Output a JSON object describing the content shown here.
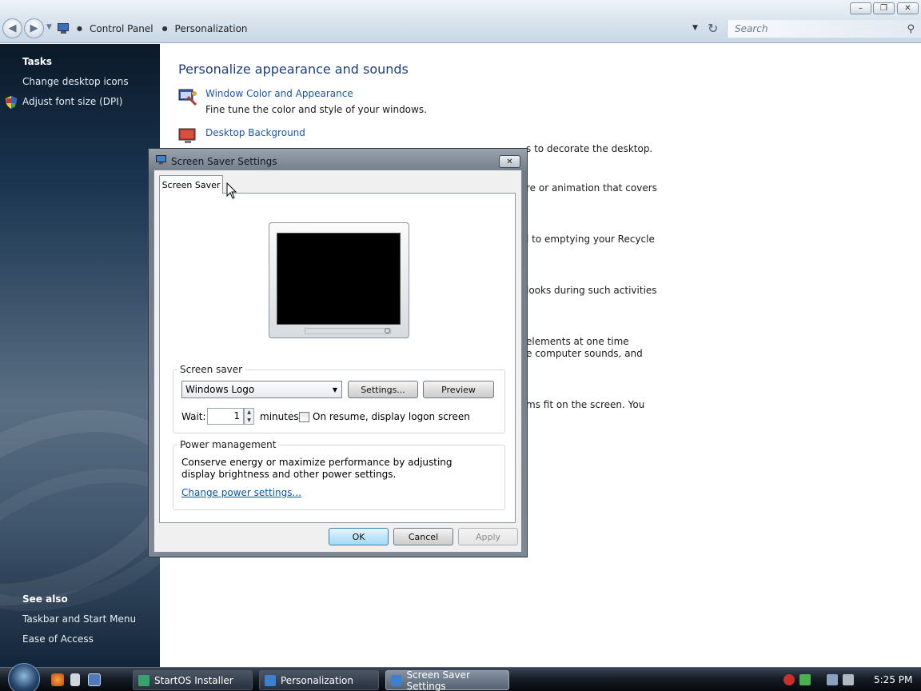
{
  "window": {
    "minimize_glyph": "–",
    "maximize_glyph": "❐",
    "close_glyph": "✕"
  },
  "address_bar": {
    "breadcrumb": [
      "Control Panel",
      "Personalization"
    ],
    "search_placeholder": "Search"
  },
  "sidebar": {
    "tasks_heading": "Tasks",
    "tasks": [
      "Change desktop icons",
      "Adjust font size (DPI)"
    ],
    "see_also_heading": "See also",
    "see_also": [
      "Taskbar and Start Menu",
      "Ease of Access"
    ]
  },
  "main": {
    "title": "Personalize appearance and sounds",
    "items": [
      {
        "link": "Window Color and Appearance",
        "desc": "Fine tune the color and style of your windows.",
        "icon": "window-color-icon"
      },
      {
        "link": "Desktop Background",
        "desc": "Choose from available backgrounds or colors or use one of your own pictures to decorate the desktop.",
        "visible_desc_tail": "s to decorate the desktop.",
        "icon": "desktop-background-icon"
      }
    ],
    "partial_text": [
      "re or animation that covers",
      "l to emptying your Recycle",
      "looks during such activities",
      "elements at one time",
      "e computer sounds, and",
      "ms fit on the screen. You"
    ]
  },
  "dialog": {
    "title": "Screen Saver Settings",
    "tab_label": "Screen Saver",
    "screen_saver_group": "Screen saver",
    "selected_saver": "Windows Logo",
    "settings_button": "Settings...",
    "preview_button": "Preview",
    "wait_label": "Wait:",
    "wait_value": "1",
    "minutes_label": "minutes",
    "resume_label": "On resume, display logon screen",
    "resume_checked": false,
    "power_group": "Power management",
    "power_desc": "Conserve energy or maximize performance by adjusting display brightness and other power settings.",
    "power_link": "Change power settings...",
    "ok": "OK",
    "cancel": "Cancel",
    "apply": "Apply"
  },
  "taskbar": {
    "buttons": [
      "StartOS Installer",
      "Personalization",
      "Screen Saver Settings"
    ],
    "active_index": 2,
    "clock": "5:25 PM"
  },
  "colors": {
    "link": "#1a55b5",
    "title": "#1e3e7a",
    "sidebar_dark": "#1a3450"
  }
}
